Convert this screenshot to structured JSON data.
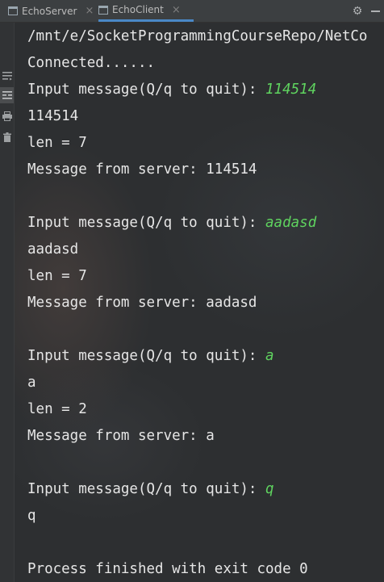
{
  "tabs": [
    {
      "label": "EchoServer",
      "icon": "console-icon",
      "active": false
    },
    {
      "label": "EchoClient",
      "icon": "console-icon",
      "active": true
    }
  ],
  "tab_close_symbol": "×",
  "toolbar": {
    "settings_icon": "⚙",
    "settings_icon_name": "gear-icon",
    "minimize_icon_name": "minimize-icon"
  },
  "gutter_icons": [
    "rerun-icon",
    "soft-wrap-icon",
    "print-icon",
    "trash-icon"
  ],
  "console": {
    "command_path": "/mnt/e/SocketProgrammingCourseRepo/NetCo",
    "connected": "Connected......",
    "prompt": "Input message(Q/q to quit): ",
    "exchanges": [
      {
        "input": "114514",
        "echo": "114514",
        "len": "len = 7",
        "response": "Message from server: 114514"
      },
      {
        "input": "aadasd",
        "echo": "aadasd",
        "len": "len = 7",
        "response": "Message from server: aadasd"
      },
      {
        "input": "a",
        "echo": "a",
        "len": "len = 2",
        "response": "Message from server: a"
      }
    ],
    "quit": {
      "input": "q",
      "echo": "q"
    },
    "exit_message": "Process finished with exit code 0"
  },
  "colors": {
    "user_input": "#5fd45f",
    "console_text": "#e6e6e6",
    "active_tab_underline": "#4a88c7"
  }
}
